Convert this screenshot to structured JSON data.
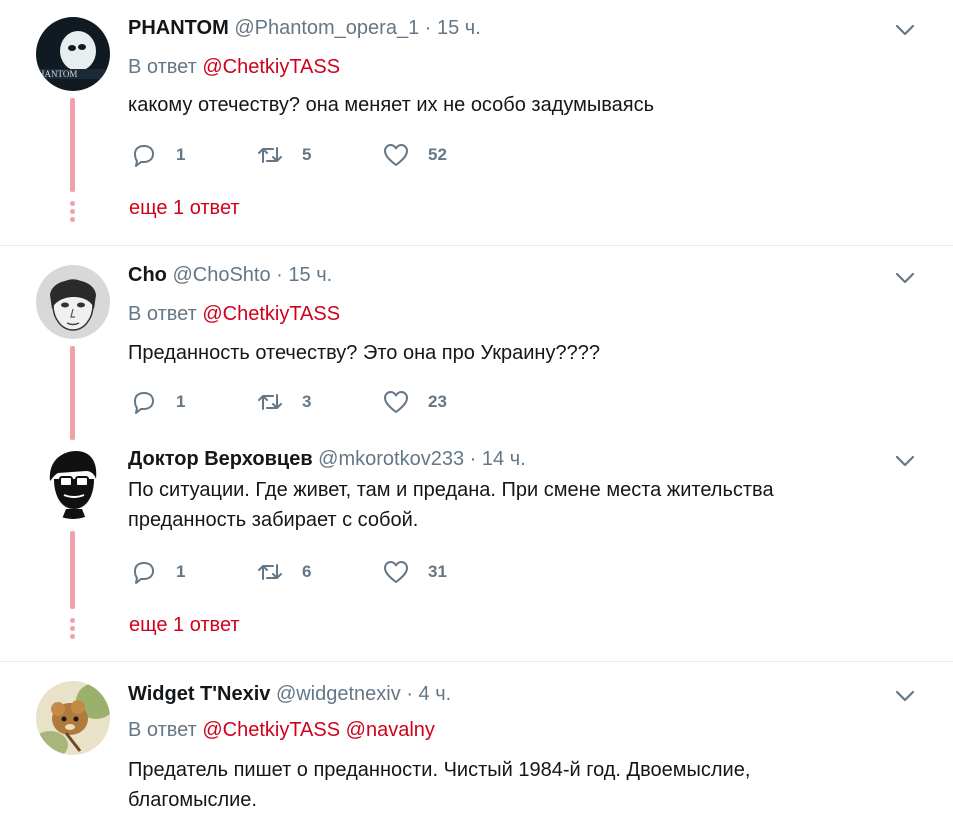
{
  "tweets": [
    {
      "name": "PHANTOM",
      "handle": "@Phantom_opera_1",
      "sep": "·",
      "time": "15 ч.",
      "reply_prefix": "В ответ",
      "reply_mentions": [
        "@ChetkiyTASS"
      ],
      "text": "какому отечеству? она меняет их не особо задумываясь",
      "replies": "1",
      "retweets": "5",
      "likes": "52",
      "more": "еще 1 ответ"
    },
    {
      "name": "Cho",
      "handle": "@ChoShto",
      "sep": "·",
      "time": "15 ч.",
      "reply_prefix": "В ответ",
      "reply_mentions": [
        "@ChetkiyTASS"
      ],
      "text": "Преданность отечеству? Это она про Украину????",
      "replies": "1",
      "retweets": "3",
      "likes": "23"
    },
    {
      "name": "Доктор Верховцев",
      "handle": "@mkorotkov233",
      "sep": "·",
      "time": "14 ч.",
      "text_lines": [
        "По ситуации. Где живет, там и предана. При смене места жительства",
        "преданность забирает с собой."
      ],
      "replies": "1",
      "retweets": "6",
      "likes": "31",
      "more": "еще 1 ответ"
    },
    {
      "name": "Widget T'Nexiv",
      "handle": "@widgetnexiv",
      "sep": "·",
      "time": "4 ч.",
      "reply_prefix": "В ответ",
      "reply_mentions": [
        "@ChetkiyTASS",
        "@navalny"
      ],
      "text_lines": [
        "Предатель пишет о преданности. Чистый 1984-й год. Двоемыслие,",
        "благомыслие."
      ]
    }
  ],
  "colors": {
    "mention": "#d0021b",
    "thread_line": "#f1a1a8",
    "muted": "#657786"
  },
  "icons": {
    "reply": "reply-icon",
    "retweet": "retweet-icon",
    "like": "heart-icon",
    "more": "chevron-down-icon"
  }
}
